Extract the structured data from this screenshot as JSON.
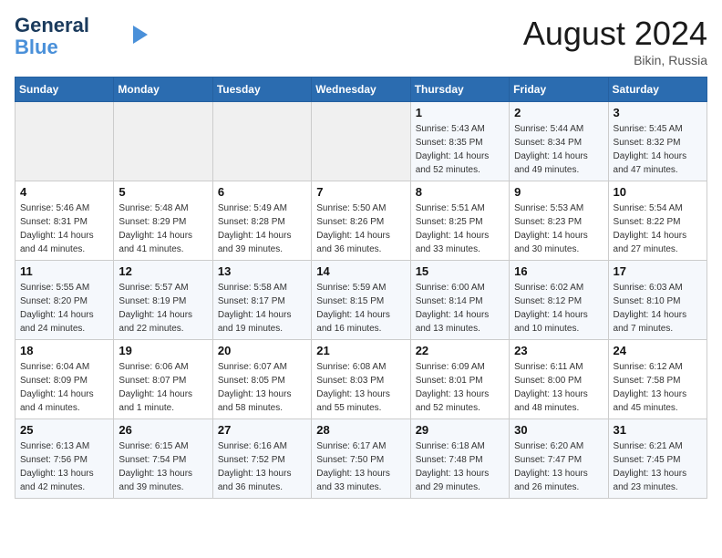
{
  "header": {
    "logo_line1": "General",
    "logo_line2": "Blue",
    "month_year": "August 2024",
    "location": "Bikin, Russia"
  },
  "weekdays": [
    "Sunday",
    "Monday",
    "Tuesday",
    "Wednesday",
    "Thursday",
    "Friday",
    "Saturday"
  ],
  "weeks": [
    [
      {
        "day": "",
        "info": ""
      },
      {
        "day": "",
        "info": ""
      },
      {
        "day": "",
        "info": ""
      },
      {
        "day": "",
        "info": ""
      },
      {
        "day": "1",
        "info": "Sunrise: 5:43 AM\nSunset: 8:35 PM\nDaylight: 14 hours\nand 52 minutes."
      },
      {
        "day": "2",
        "info": "Sunrise: 5:44 AM\nSunset: 8:34 PM\nDaylight: 14 hours\nand 49 minutes."
      },
      {
        "day": "3",
        "info": "Sunrise: 5:45 AM\nSunset: 8:32 PM\nDaylight: 14 hours\nand 47 minutes."
      }
    ],
    [
      {
        "day": "4",
        "info": "Sunrise: 5:46 AM\nSunset: 8:31 PM\nDaylight: 14 hours\nand 44 minutes."
      },
      {
        "day": "5",
        "info": "Sunrise: 5:48 AM\nSunset: 8:29 PM\nDaylight: 14 hours\nand 41 minutes."
      },
      {
        "day": "6",
        "info": "Sunrise: 5:49 AM\nSunset: 8:28 PM\nDaylight: 14 hours\nand 39 minutes."
      },
      {
        "day": "7",
        "info": "Sunrise: 5:50 AM\nSunset: 8:26 PM\nDaylight: 14 hours\nand 36 minutes."
      },
      {
        "day": "8",
        "info": "Sunrise: 5:51 AM\nSunset: 8:25 PM\nDaylight: 14 hours\nand 33 minutes."
      },
      {
        "day": "9",
        "info": "Sunrise: 5:53 AM\nSunset: 8:23 PM\nDaylight: 14 hours\nand 30 minutes."
      },
      {
        "day": "10",
        "info": "Sunrise: 5:54 AM\nSunset: 8:22 PM\nDaylight: 14 hours\nand 27 minutes."
      }
    ],
    [
      {
        "day": "11",
        "info": "Sunrise: 5:55 AM\nSunset: 8:20 PM\nDaylight: 14 hours\nand 24 minutes."
      },
      {
        "day": "12",
        "info": "Sunrise: 5:57 AM\nSunset: 8:19 PM\nDaylight: 14 hours\nand 22 minutes."
      },
      {
        "day": "13",
        "info": "Sunrise: 5:58 AM\nSunset: 8:17 PM\nDaylight: 14 hours\nand 19 minutes."
      },
      {
        "day": "14",
        "info": "Sunrise: 5:59 AM\nSunset: 8:15 PM\nDaylight: 14 hours\nand 16 minutes."
      },
      {
        "day": "15",
        "info": "Sunrise: 6:00 AM\nSunset: 8:14 PM\nDaylight: 14 hours\nand 13 minutes."
      },
      {
        "day": "16",
        "info": "Sunrise: 6:02 AM\nSunset: 8:12 PM\nDaylight: 14 hours\nand 10 minutes."
      },
      {
        "day": "17",
        "info": "Sunrise: 6:03 AM\nSunset: 8:10 PM\nDaylight: 14 hours\nand 7 minutes."
      }
    ],
    [
      {
        "day": "18",
        "info": "Sunrise: 6:04 AM\nSunset: 8:09 PM\nDaylight: 14 hours\nand 4 minutes."
      },
      {
        "day": "19",
        "info": "Sunrise: 6:06 AM\nSunset: 8:07 PM\nDaylight: 14 hours\nand 1 minute."
      },
      {
        "day": "20",
        "info": "Sunrise: 6:07 AM\nSunset: 8:05 PM\nDaylight: 13 hours\nand 58 minutes."
      },
      {
        "day": "21",
        "info": "Sunrise: 6:08 AM\nSunset: 8:03 PM\nDaylight: 13 hours\nand 55 minutes."
      },
      {
        "day": "22",
        "info": "Sunrise: 6:09 AM\nSunset: 8:01 PM\nDaylight: 13 hours\nand 52 minutes."
      },
      {
        "day": "23",
        "info": "Sunrise: 6:11 AM\nSunset: 8:00 PM\nDaylight: 13 hours\nand 48 minutes."
      },
      {
        "day": "24",
        "info": "Sunrise: 6:12 AM\nSunset: 7:58 PM\nDaylight: 13 hours\nand 45 minutes."
      }
    ],
    [
      {
        "day": "25",
        "info": "Sunrise: 6:13 AM\nSunset: 7:56 PM\nDaylight: 13 hours\nand 42 minutes."
      },
      {
        "day": "26",
        "info": "Sunrise: 6:15 AM\nSunset: 7:54 PM\nDaylight: 13 hours\nand 39 minutes."
      },
      {
        "day": "27",
        "info": "Sunrise: 6:16 AM\nSunset: 7:52 PM\nDaylight: 13 hours\nand 36 minutes."
      },
      {
        "day": "28",
        "info": "Sunrise: 6:17 AM\nSunset: 7:50 PM\nDaylight: 13 hours\nand 33 minutes."
      },
      {
        "day": "29",
        "info": "Sunrise: 6:18 AM\nSunset: 7:48 PM\nDaylight: 13 hours\nand 29 minutes."
      },
      {
        "day": "30",
        "info": "Sunrise: 6:20 AM\nSunset: 7:47 PM\nDaylight: 13 hours\nand 26 minutes."
      },
      {
        "day": "31",
        "info": "Sunrise: 6:21 AM\nSunset: 7:45 PM\nDaylight: 13 hours\nand 23 minutes."
      }
    ]
  ]
}
